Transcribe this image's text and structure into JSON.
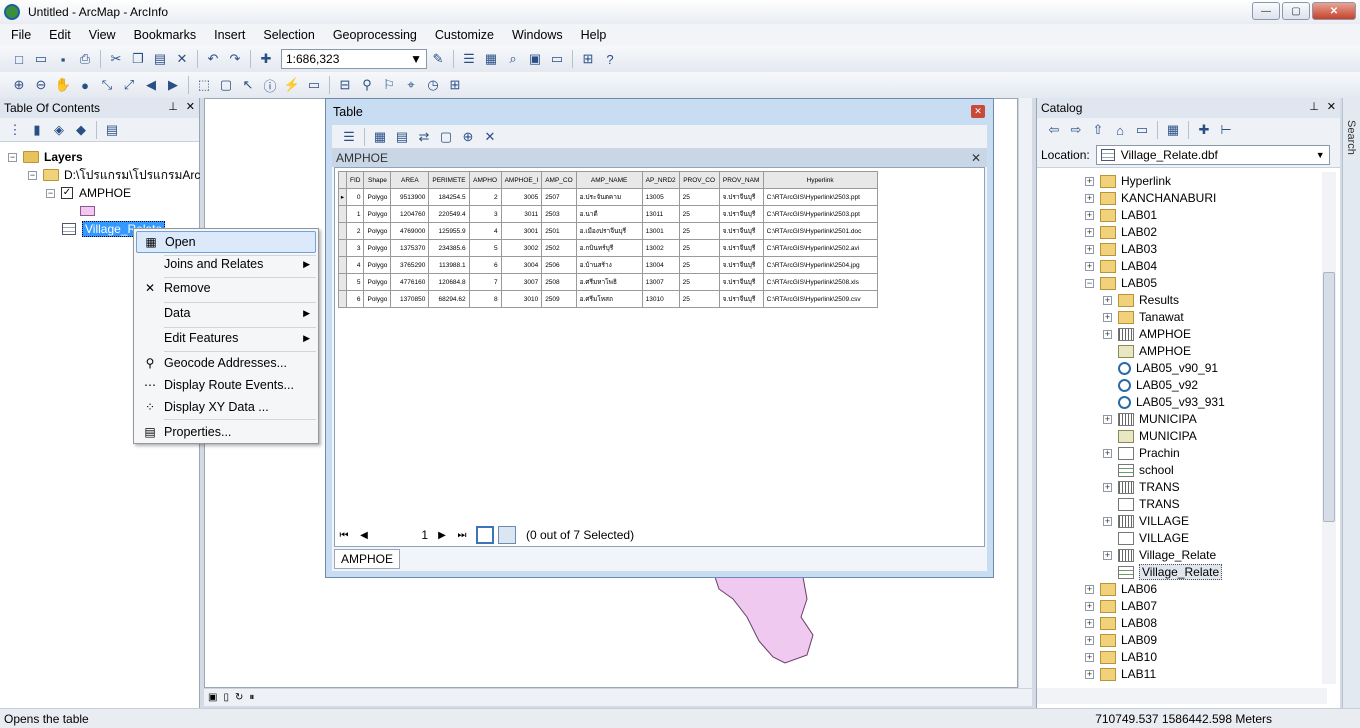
{
  "window": {
    "title": "Untitled - ArcMap - ArcInfo",
    "min": "—",
    "max": "▢",
    "close": "✕"
  },
  "menu": [
    "File",
    "Edit",
    "View",
    "Bookmarks",
    "Insert",
    "Selection",
    "Geoprocessing",
    "Customize",
    "Windows",
    "Help"
  ],
  "toolbar": {
    "scale": "1:686,323"
  },
  "toc": {
    "title": "Table Of Contents",
    "layers_label": "Layers",
    "folder_label": "D:\\โปรแกรม\\โปรแกรมArc",
    "amphoe_label": "AMPHOE",
    "village_label": "Village_Relate"
  },
  "context_menu": {
    "open": "Open",
    "joins": "Joins and Relates",
    "remove": "Remove",
    "data": "Data",
    "edit_features": "Edit Features",
    "geocode": "Geocode Addresses...",
    "route_events": "Display Route Events...",
    "xy_data": "Display XY Data ...",
    "properties": "Properties..."
  },
  "table_window": {
    "title": "Table",
    "table_name": "AMPHOE",
    "columns": [
      "FID",
      "Shape",
      "AREA",
      "PERIMETE",
      "AMPHO",
      "AMPHOE_I",
      "AMP_CO",
      "AMP_NAME",
      "AP_NRD2",
      "PROV_CO",
      "PROV_NAM",
      "Hyperlink"
    ],
    "rows": [
      [
        "0",
        "Polygo",
        "9513900",
        "184254.5",
        "2",
        "3005",
        "2507",
        "อ.ประจันตคาม",
        "13005",
        "25",
        "จ.ปราจีนบุรี",
        "C:\\RTArcGIS\\Hyperlink\\2503.ppt"
      ],
      [
        "1",
        "Polygo",
        "1204760",
        "220549.4",
        "3",
        "3011",
        "2503",
        "อ.นาดี",
        "13011",
        "25",
        "จ.ปราจีนบุรี",
        "C:\\RTArcGIS\\Hyperlink\\2503.ppt"
      ],
      [
        "2",
        "Polygo",
        "4769000",
        "125955.9",
        "4",
        "3001",
        "2501",
        "อ.เมืองปราจีนบุรี",
        "13001",
        "25",
        "จ.ปราจีนบุรี",
        "C:\\RTArcGIS\\Hyperlink\\2501.doc"
      ],
      [
        "3",
        "Polygo",
        "1375370",
        "234385.6",
        "5",
        "3002",
        "2502",
        "อ.กบินทร์บุรี",
        "13002",
        "25",
        "จ.ปราจีนบุรี",
        "C:\\RTArcGIS\\Hyperlink\\2502.avi"
      ],
      [
        "4",
        "Polygo",
        "3765290",
        "113988.1",
        "6",
        "3004",
        "2506",
        "อ.บ้านสร้าง",
        "13004",
        "25",
        "จ.ปราจีนบุรี",
        "C:\\RTArcGIS\\Hyperlink\\2504.jpg"
      ],
      [
        "5",
        "Polygo",
        "4776160",
        "120684.8",
        "7",
        "3007",
        "2508",
        "อ.ศรีมหาโพธิ",
        "13007",
        "25",
        "จ.ปราจีนบุรี",
        "C:\\RTArcGIS\\Hyperlink\\2508.xls"
      ],
      [
        "6",
        "Polygo",
        "1370850",
        "68294.62",
        "8",
        "3010",
        "2509",
        "อ.ศรีมโหสถ",
        "13010",
        "25",
        "จ.ปราจีนบุรี",
        "C:\\RTArcGIS\\Hyperlink\\2509.csv"
      ]
    ],
    "page": "1",
    "selection_status": "(0 out of 7 Selected)",
    "tab": "AMPHOE"
  },
  "catalog": {
    "title": "Catalog",
    "location_label": "Location:",
    "location_value": "Village_Relate.dbf",
    "items": [
      {
        "label": "Hyperlink",
        "icon": "folder",
        "level": 0,
        "exp": "+"
      },
      {
        "label": "KANCHANABURI",
        "icon": "folder",
        "level": 0,
        "exp": "+"
      },
      {
        "label": "LAB01",
        "icon": "folder",
        "level": 0,
        "exp": "+"
      },
      {
        "label": "LAB02",
        "icon": "folder",
        "level": 0,
        "exp": "+"
      },
      {
        "label": "LAB03",
        "icon": "folder",
        "level": 0,
        "exp": "+"
      },
      {
        "label": "LAB04",
        "icon": "folder",
        "level": 0,
        "exp": "+"
      },
      {
        "label": "LAB05",
        "icon": "folder",
        "level": 0,
        "exp": "-"
      },
      {
        "label": "Results",
        "icon": "folder",
        "level": 1,
        "exp": "+"
      },
      {
        "label": "Tanawat",
        "icon": "folder",
        "level": 1,
        "exp": "+"
      },
      {
        "label": "AMPHOE",
        "icon": "grid",
        "level": 1,
        "exp": "+"
      },
      {
        "label": "AMPHOE",
        "icon": "cov",
        "level": 1,
        "exp": ""
      },
      {
        "label": "LAB05_v90_91",
        "icon": "mxd",
        "level": 1,
        "exp": ""
      },
      {
        "label": "LAB05_v92",
        "icon": "mxd",
        "level": 1,
        "exp": ""
      },
      {
        "label": "LAB05_v93_931",
        "icon": "mxd",
        "level": 1,
        "exp": ""
      },
      {
        "label": "MUNICIPA",
        "icon": "grid",
        "level": 1,
        "exp": "+"
      },
      {
        "label": "MUNICIPA",
        "icon": "cov",
        "level": 1,
        "exp": ""
      },
      {
        "label": "Prachin",
        "icon": "poly",
        "level": 1,
        "exp": "+"
      },
      {
        "label": "school",
        "icon": "tbl",
        "level": 1,
        "exp": ""
      },
      {
        "label": "TRANS",
        "icon": "grid",
        "level": 1,
        "exp": "+"
      },
      {
        "label": "TRANS",
        "icon": "line",
        "level": 1,
        "exp": ""
      },
      {
        "label": "VILLAGE",
        "icon": "grid",
        "level": 1,
        "exp": "+"
      },
      {
        "label": "VILLAGE",
        "icon": "point",
        "level": 1,
        "exp": ""
      },
      {
        "label": "Village_Relate",
        "icon": "grid",
        "level": 1,
        "exp": "+"
      },
      {
        "label": "Village_Relate",
        "icon": "tbl",
        "level": 1,
        "exp": "",
        "selected": true
      },
      {
        "label": "LAB06",
        "icon": "folder",
        "level": 0,
        "exp": "+"
      },
      {
        "label": "LAB07",
        "icon": "folder",
        "level": 0,
        "exp": "+"
      },
      {
        "label": "LAB08",
        "icon": "folder",
        "level": 0,
        "exp": "+"
      },
      {
        "label": "LAB09",
        "icon": "folder",
        "level": 0,
        "exp": "+"
      },
      {
        "label": "LAB10",
        "icon": "folder",
        "level": 0,
        "exp": "+"
      },
      {
        "label": "LAB11",
        "icon": "folder",
        "level": 0,
        "exp": "+"
      }
    ]
  },
  "side_tab": "Search",
  "status": {
    "message": "Opens the table",
    "coords": "710749.537  1586442.598 Meters"
  },
  "colors": {
    "polygon_fill": "#f0c9f0",
    "selection": "#3399ff"
  }
}
